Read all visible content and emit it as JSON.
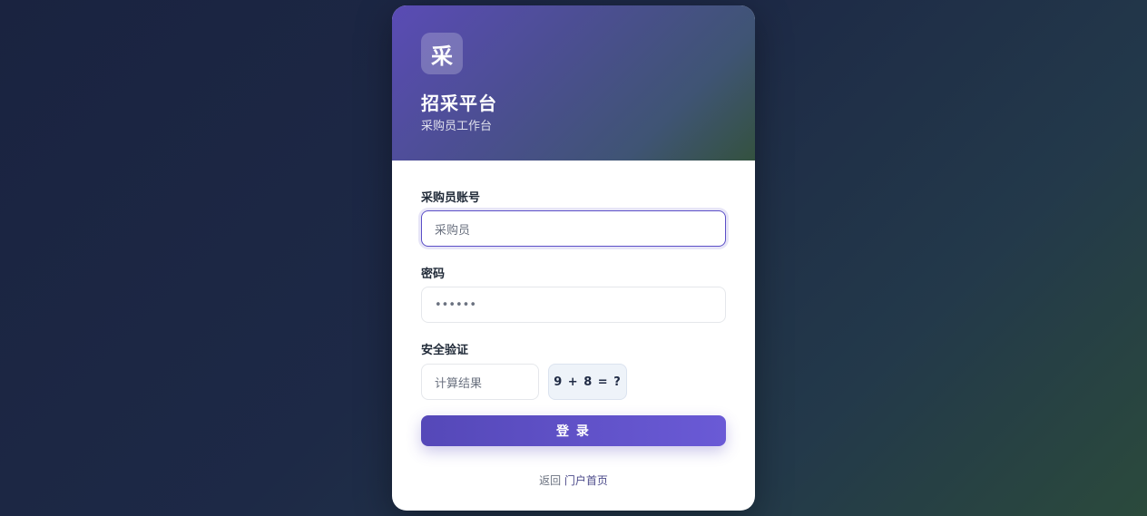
{
  "header": {
    "logo_char": "采",
    "title": "招采平台",
    "subtitle": "采购员工作台"
  },
  "form": {
    "account_label": "采购员账号",
    "account_value": "采购员",
    "password_label": "密码",
    "password_value": "••••••",
    "captcha_label": "安全验证",
    "captcha_placeholder": "计算结果",
    "captcha_question": "9 + 8 = ?",
    "login_label": "登 录"
  },
  "footer": {
    "prefix": "返回",
    "link": "门户首页"
  },
  "colors": {
    "accent": "#5b4fc7",
    "button_start": "#5548b8",
    "button_end": "#6a5ad6"
  }
}
